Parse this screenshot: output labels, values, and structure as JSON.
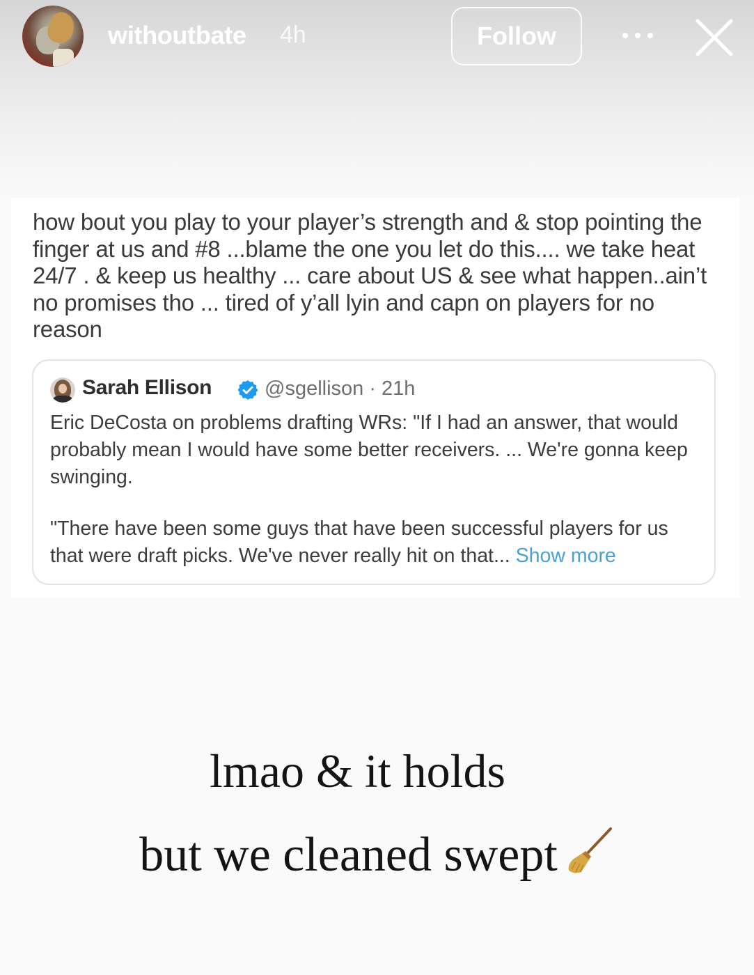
{
  "header": {
    "username": "withoutbate",
    "time_ago": "4h",
    "follow_label": "Follow",
    "more_icon": "more-horizontal-icon",
    "close_icon": "close-icon"
  },
  "tweet": {
    "text": "how bout you play to your player’s strength and & stop pointing the finger at us and #8 ...blame the one you let do this.... we take heat 24/7 . & keep us healthy ... care about US & see what happen..ain’t no promises tho ... tired of y’all lyin and capn on players for no reason",
    "quoted": {
      "name": "Sarah Ellison",
      "handle_time": "@sgellison · 21h",
      "paragraph_1": "Eric DeCosta on problems drafting WRs: \"If I had an answer, that would probably mean I would have some better receivers. ... We're gonna keep swinging.",
      "paragraph_2": "\"There have been some guys that have been successful players for us that were draft picks. We've never really hit on that...",
      "show_more": "Show more",
      "verified_color": "#1d9bf0"
    }
  },
  "caption": {
    "line_1": "lmao & it holds",
    "line_2": "but we cleaned swept",
    "emoji_icon": "broom-icon"
  },
  "colors": {
    "link": "#4a9fd8",
    "caption_text": "#141414"
  }
}
